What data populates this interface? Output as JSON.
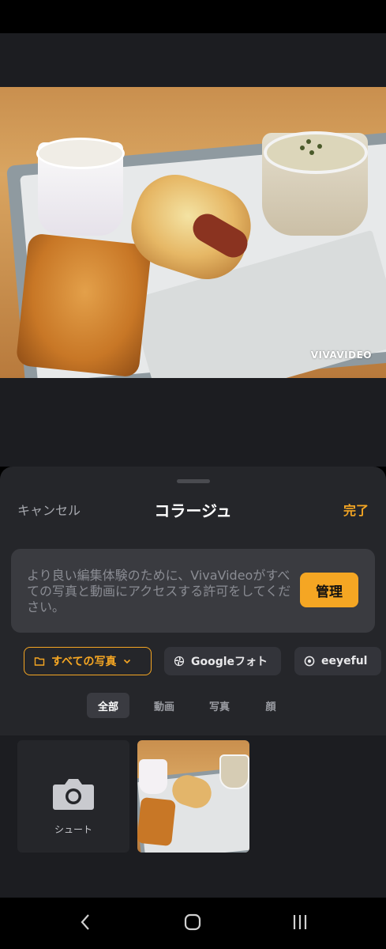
{
  "preview": {
    "watermark": "VIVAVIDEO"
  },
  "sheet": {
    "cancel_label": "キャンセル",
    "title": "コラージュ",
    "done_label": "完了"
  },
  "permission": {
    "message": "より良い編集体験のために、VivaVideoがすべての写真と動画にアクセスする許可をしてください。",
    "manage_label": "管理"
  },
  "sources": {
    "items": [
      {
        "label": "すべての写真",
        "icon": "folder-icon",
        "active": true
      },
      {
        "label": "Googleフォト",
        "icon": "pinwheel-icon",
        "active": false
      },
      {
        "label": "eeyeful",
        "icon": "eye-icon",
        "active": false
      }
    ]
  },
  "filters": {
    "items": [
      {
        "label": "全部",
        "active": true
      },
      {
        "label": "動画",
        "active": false
      },
      {
        "label": "写真",
        "active": false
      },
      {
        "label": "顔",
        "active": false
      }
    ]
  },
  "gallery": {
    "camera_label": "シュート"
  },
  "colors": {
    "accent": "#f5a623",
    "sheet_bg": "#25262a",
    "card_bg": "#3a3b40"
  }
}
